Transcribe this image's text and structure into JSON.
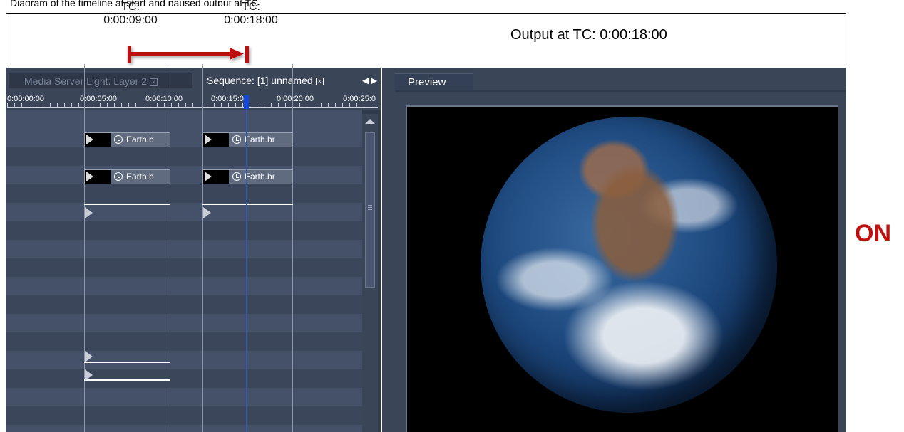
{
  "top_caption": "Diagram of the timeline at start and paused output at TC",
  "annotations": {
    "tc_start": {
      "label": "TC:",
      "value": "0:00:09:00"
    },
    "tc_end": {
      "label": "TC:",
      "value": "0:00:18:00"
    },
    "arrow_color": "#c01010"
  },
  "output": {
    "title": "Output at TC: 0:00:18:00"
  },
  "status": {
    "label": "ON",
    "color": "#c01010"
  },
  "sequence_panel": {
    "tabs": [
      {
        "label": "Media Server Light: Layer 2"
      },
      {
        "label": "Sequence: [1] unnamed"
      }
    ],
    "ruler": [
      "0:00:00:00",
      "0:00:05:00",
      "0:00:10:00",
      "0:00:15:00",
      "0:00:20:00",
      "0:00:25:0"
    ],
    "clips": [
      {
        "label": "Earth.b"
      },
      {
        "label": "Earth.br"
      },
      {
        "label": "Earth.b"
      },
      {
        "label": "Earth.br"
      }
    ]
  },
  "preview_panel": {
    "tab_label": "Preview"
  }
}
